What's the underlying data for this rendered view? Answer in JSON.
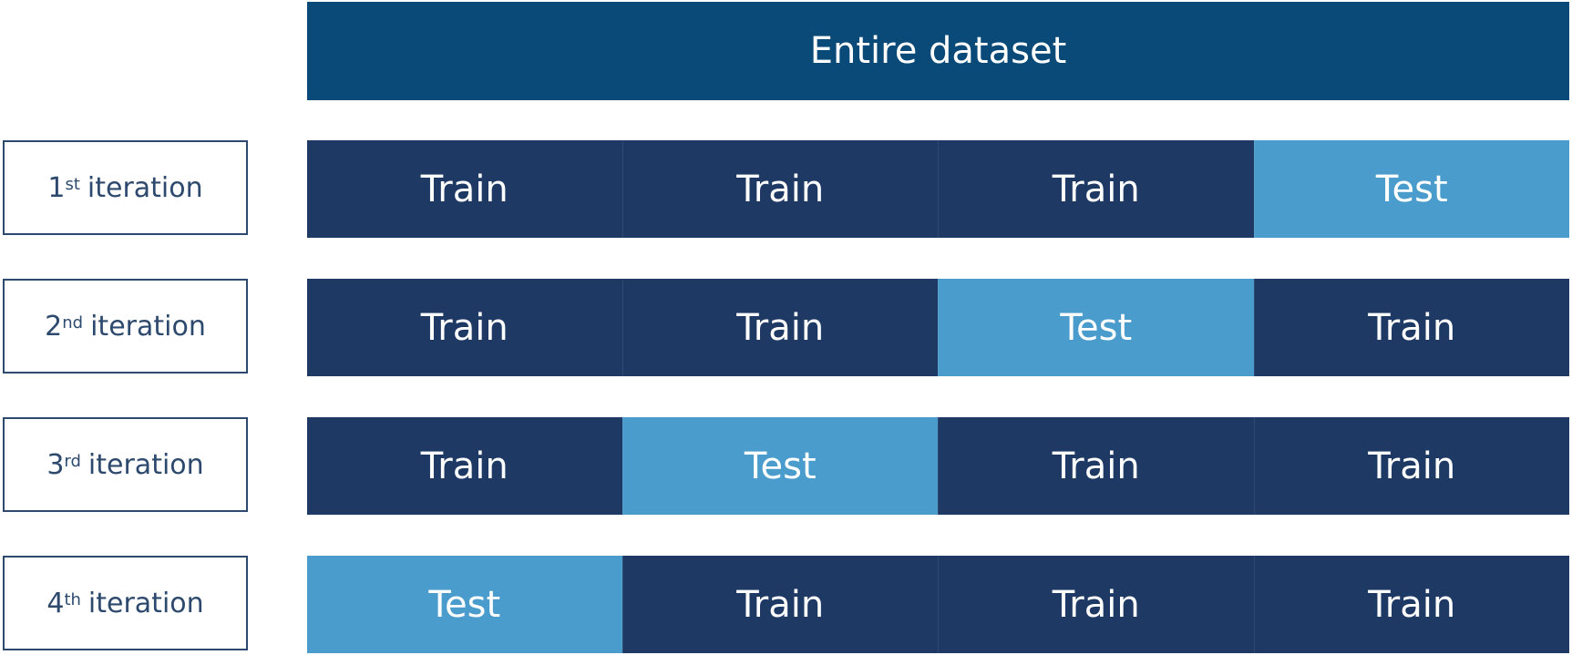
{
  "header": {
    "label": "Entire dataset",
    "color": "#0a4a78"
  },
  "colors": {
    "train": "#1e3a64",
    "test": "#4a9ccc",
    "label_border": "#2d4a6e",
    "label_text": "#2d4a6e"
  },
  "iterations": [
    {
      "num": "1",
      "suffix": "st",
      "text": "iteration",
      "cells": [
        "Train",
        "Train",
        "Train",
        "Test"
      ]
    },
    {
      "num": "2",
      "suffix": "nd",
      "text": "iteration",
      "cells": [
        "Train",
        "Train",
        "Test",
        "Train"
      ]
    },
    {
      "num": "3",
      "suffix": "rd",
      "text": "iteration",
      "cells": [
        "Train",
        "Test",
        "Train",
        "Train"
      ]
    },
    {
      "num": "4",
      "suffix": "th",
      "text": "iteration",
      "cells": [
        "Test",
        "Train",
        "Train",
        "Train"
      ]
    }
  ]
}
